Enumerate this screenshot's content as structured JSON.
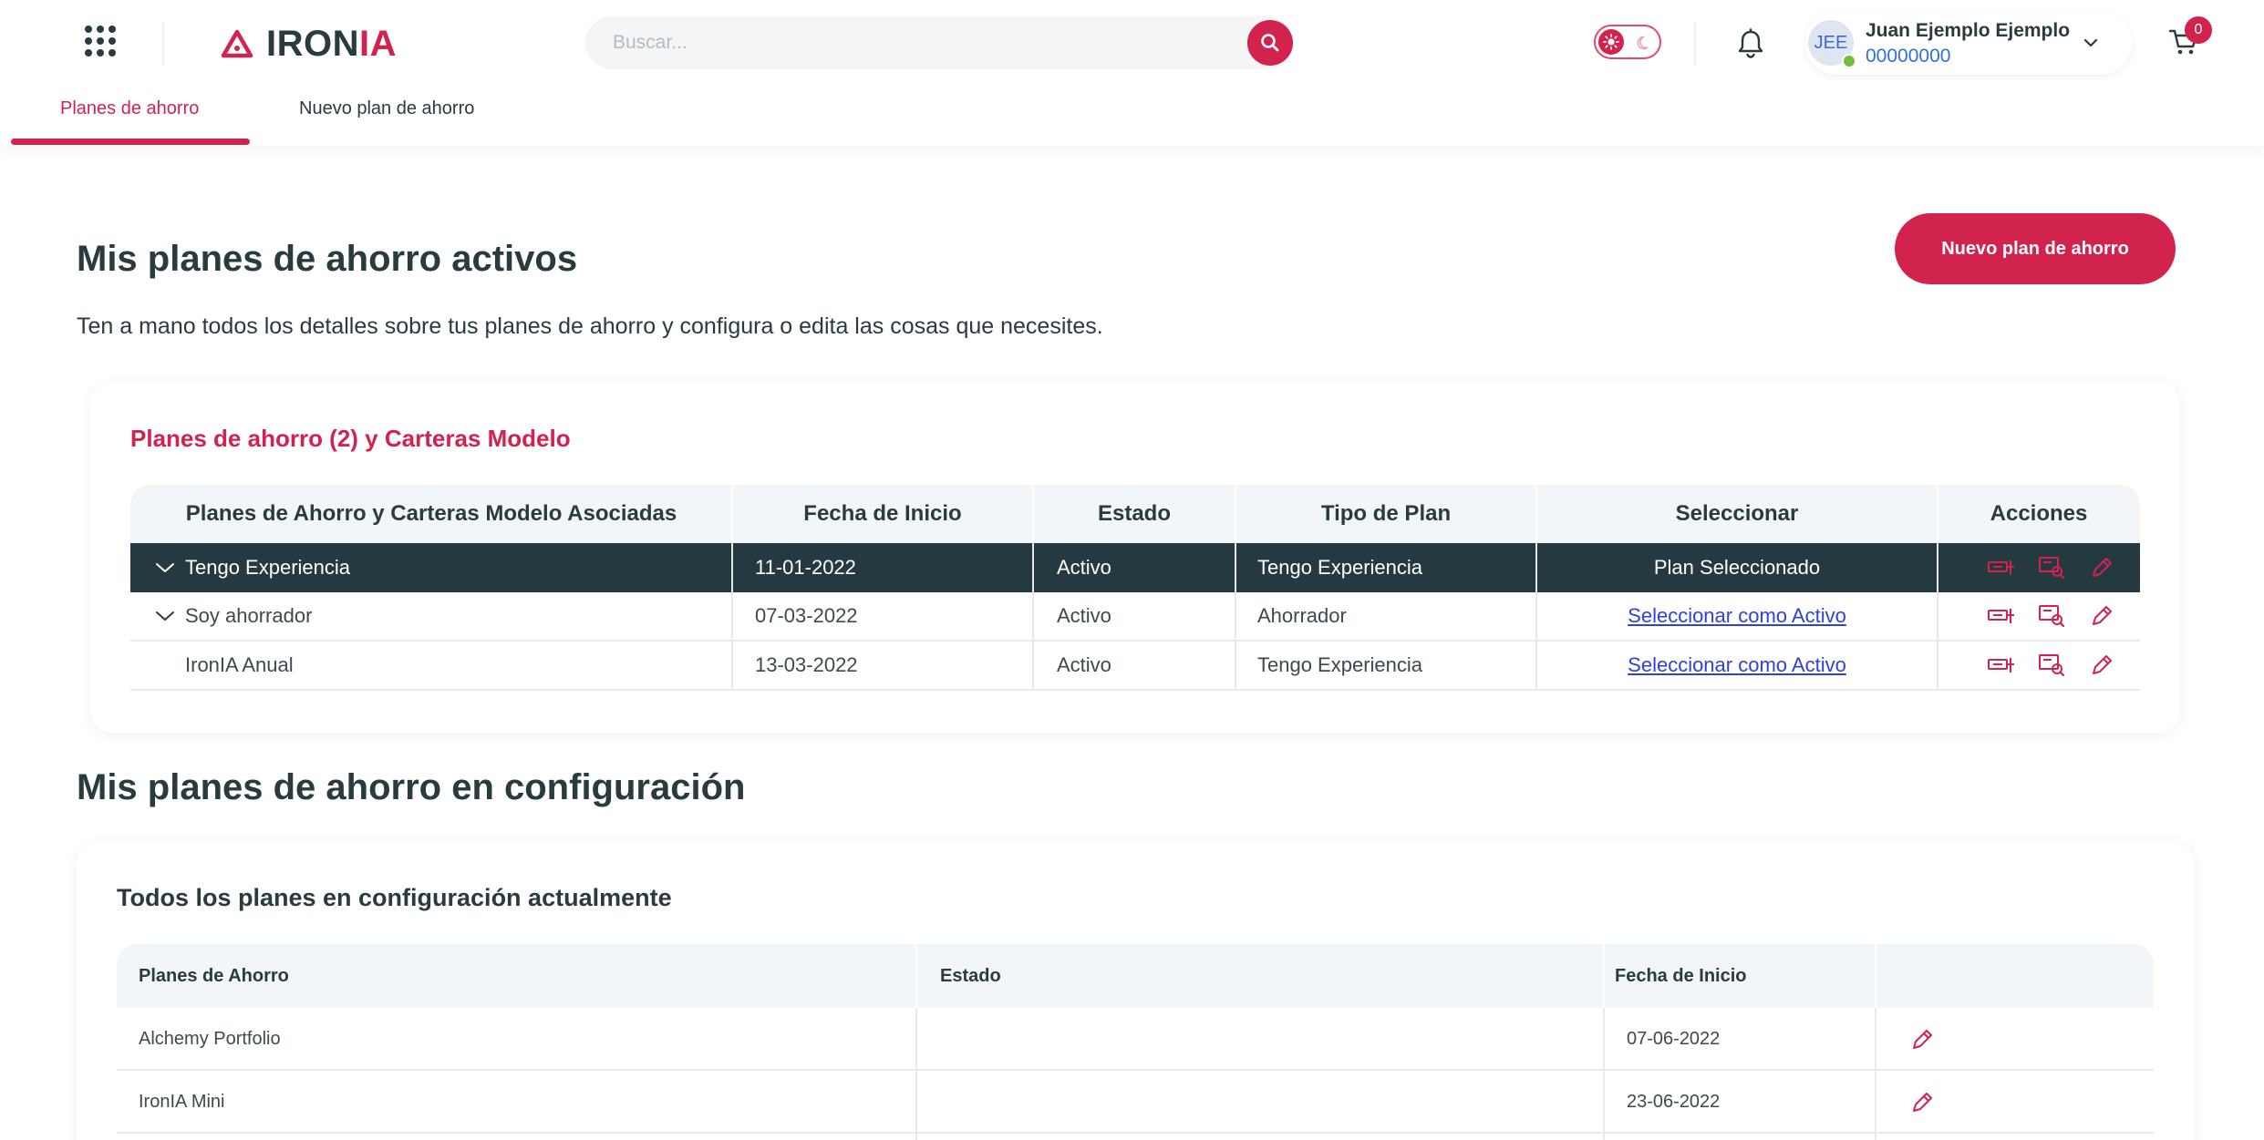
{
  "brand": {
    "name_main": "IRON",
    "name_accent": "IA",
    "accent_color": "#d2234f",
    "dark_color": "#253a40"
  },
  "header": {
    "search_placeholder": "Buscar...",
    "user_initials": "JEE",
    "user_name": "Juan Ejemplo Ejemplo",
    "user_id": "00000000",
    "cart_count": "0"
  },
  "tabs": [
    {
      "label": "Planes de ahorro",
      "active": true
    },
    {
      "label": "Nuevo plan de ahorro",
      "active": false
    }
  ],
  "active_section": {
    "title": "Mis planes de ahorro activos",
    "subtitle": "Ten a mano todos los detalles sobre tus planes de ahorro y configura o edita las cosas que necesites.",
    "new_plan_button": "Nuevo plan de ahorro",
    "card_title": "Planes de ahorro (2) y Carteras Modelo",
    "columns": [
      "Planes de Ahorro y Carteras Modelo Asociadas",
      "Fecha de Inicio",
      "Estado",
      "Tipo de Plan",
      "Seleccionar",
      "Acciones"
    ],
    "rows": [
      {
        "name": "Tengo Experiencia",
        "date": "11-01-2022",
        "status": "Activo",
        "type": "Tengo Experiencia",
        "select": "Plan Seleccionado",
        "selected": true,
        "expandable": true
      },
      {
        "name": "Soy ahorrador",
        "date": "07-03-2022",
        "status": "Activo",
        "type": "Ahorrador",
        "select": "Seleccionar como Activo",
        "selected": false,
        "expandable": true
      },
      {
        "name": "IronIA Anual",
        "date": "13-03-2022",
        "status": "Activo",
        "type": "Tengo Experiencia",
        "select": "Seleccionar como Activo",
        "selected": false,
        "expandable": false
      }
    ]
  },
  "config_section": {
    "title": "Mis planes de ahorro en configuración",
    "card_title": "Todos los planes en configuración actualmente",
    "columns": [
      "Planes de Ahorro",
      "Estado",
      "Fecha de Inicio",
      ""
    ],
    "rows": [
      {
        "name": "Alchemy Portfolio",
        "status": "",
        "date": "07-06-2022"
      },
      {
        "name": "IronIA Mini",
        "status": "",
        "date": "23-06-2022"
      }
    ]
  }
}
